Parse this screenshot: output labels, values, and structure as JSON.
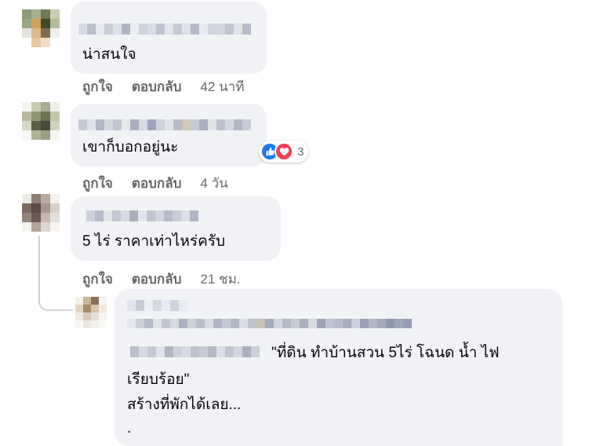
{
  "comments": [
    {
      "text": "น่าสนใจ",
      "like_label": "ถูกใจ",
      "reply_label": "ตอบกลับ",
      "time": "42 นาที"
    },
    {
      "text": "เขาก็บอกอยู่นะ",
      "like_label": "ถูกใจ",
      "reply_label": "ตอบกลับ",
      "time": "4 วัน",
      "reactions": {
        "count": "3",
        "icons": [
          "like-icon",
          "love-icon"
        ]
      }
    },
    {
      "text": "5 ไร่ ราคาเท่าไหร่ครับ",
      "like_label": "ถูกใจ",
      "reply_label": "ตอบกลับ",
      "time": "21 ชม."
    }
  ],
  "reply": {
    "quote_line1": "\"ที่ดิน ทำบ้านสวน 5ไร่ โฉนด น้ำ ไฟ",
    "quote_line2": "เรียบร้อย\"",
    "line3": "สร้างที่พักได้เลย...",
    "line4": "."
  },
  "colors": {
    "bubble": "#f0f2f5",
    "meta_text": "#65676b",
    "like_blue": "#1877f2",
    "love_red": "#f33e58"
  }
}
